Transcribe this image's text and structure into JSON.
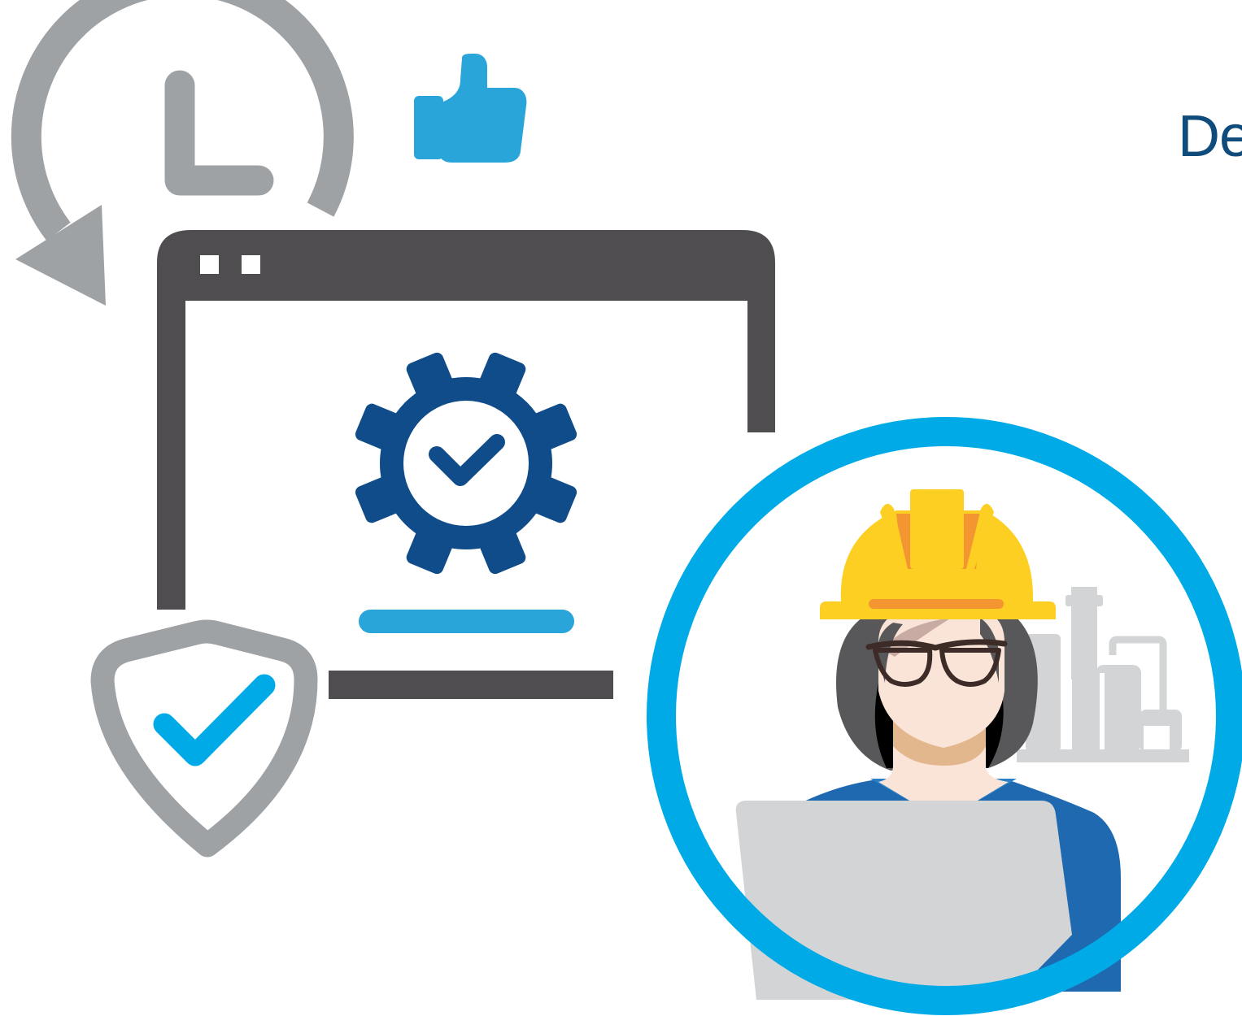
{
  "heading": {
    "visible_text": "De"
  },
  "illustration": {
    "icons": [
      "history-clock-icon",
      "thumbs-up-icon",
      "browser-window-icon",
      "gear-check-icon",
      "progress-bar-icon",
      "shield-check-icon",
      "engineer-avatar-icon",
      "factory-icon",
      "laptop-icon"
    ],
    "progress_fraction": 1.0
  },
  "colors": {
    "gray": "#9fa2a5",
    "dark_gray": "#4f4d50",
    "navy": "#0f4c89",
    "sky_blue": "#2aa5da",
    "cyan_ring": "#00aae6",
    "helmet_yellow": "#fdcf23",
    "helmet_orange": "#f39530",
    "shirt_blue": "#1f69b1",
    "light_gray": "#d3d4d6",
    "skin": "#fae4d7",
    "text_blue": "#0f4c7c"
  }
}
